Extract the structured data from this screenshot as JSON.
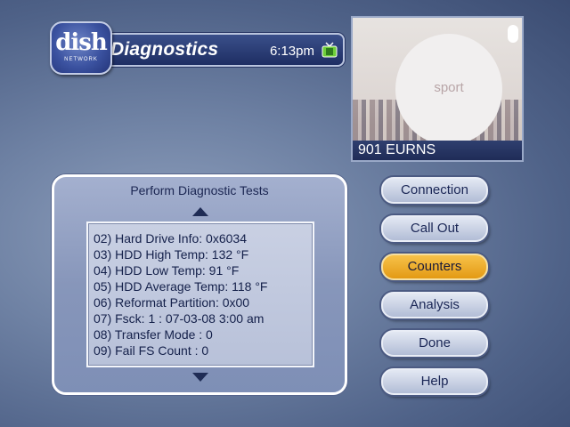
{
  "header": {
    "logo_text": "dish",
    "logo_subtext": "NETWORK",
    "title": "Diagnostics",
    "time": "6:13pm",
    "icons": [
      "tv-icon"
    ]
  },
  "preview": {
    "overlay_text": "sport",
    "channel_label": "901 EURNS"
  },
  "panel": {
    "title": "Perform Diagnostic Tests",
    "items": [
      "02) Hard Drive Info: 0x6034",
      "03) HDD High Temp: 132 °F",
      "04) HDD Low Temp: 91 °F",
      "05) HDD Average Temp: 118 °F",
      "06) Reformat Partition: 0x00",
      "07) Fsck: 1 : 07-03-08 3:00 am",
      "08) Transfer Mode  :  0",
      "09) Fail FS Count  :  0"
    ]
  },
  "buttons": [
    {
      "label": "Connection"
    },
    {
      "label": "Call Out"
    },
    {
      "label": "Counters",
      "active": true
    },
    {
      "label": "Analysis"
    },
    {
      "label": "Done"
    },
    {
      "label": "Help"
    }
  ],
  "colors": {
    "accent_active": "#f0b030",
    "title_bar": "#2a3c78"
  }
}
